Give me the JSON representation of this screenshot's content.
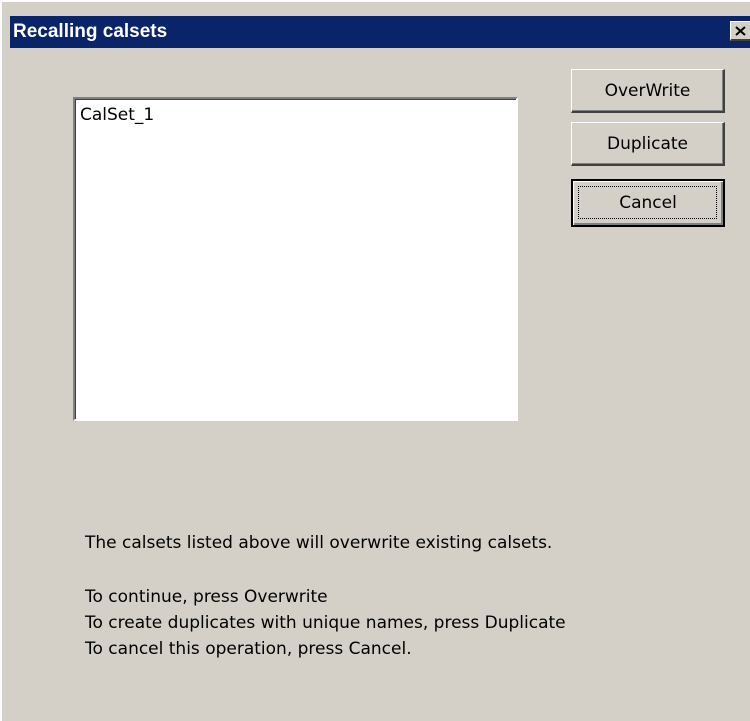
{
  "window": {
    "title": "Recalling calsets",
    "close_icon": "close-icon"
  },
  "calset_list": {
    "items": [
      "CalSet_1"
    ]
  },
  "buttons": {
    "overwrite_label": "OverWrite",
    "duplicate_label": "Duplicate",
    "cancel_label": "Cancel"
  },
  "message": {
    "line1": "The calsets listed above will overwrite existing calsets.",
    "line2": "To continue, press Overwrite",
    "line3": "To create duplicates with unique names, press Duplicate",
    "line4": "To cancel this operation, press Cancel."
  },
  "colors": {
    "titlebar": "#0a246a",
    "dialog_face": "#d4d0c8"
  }
}
